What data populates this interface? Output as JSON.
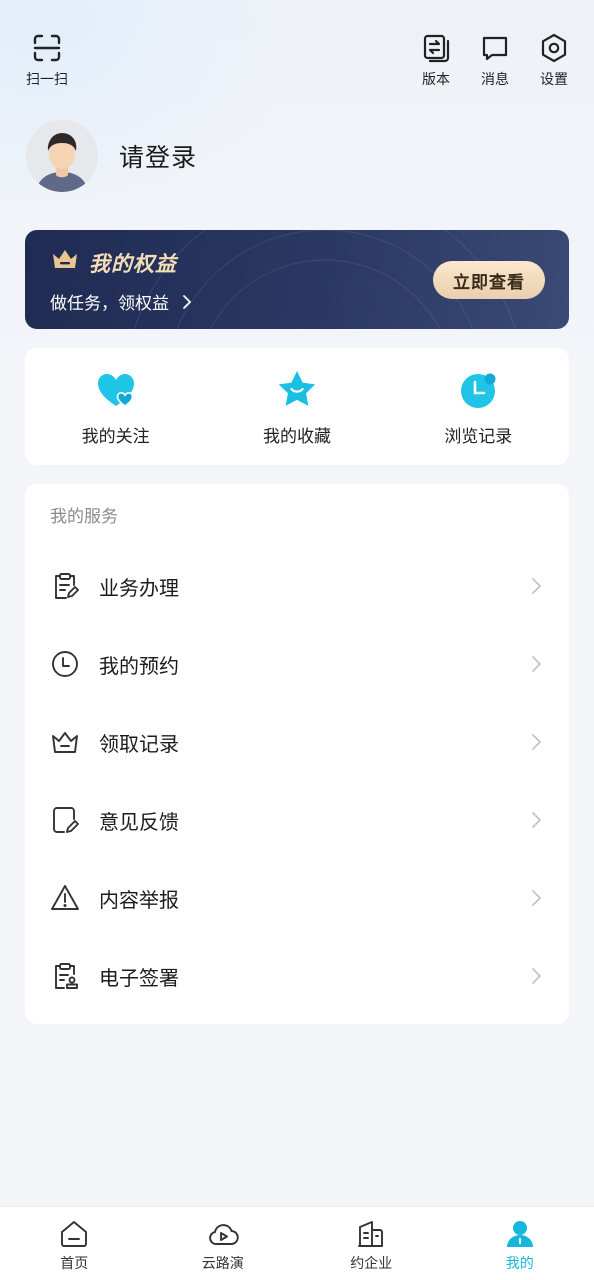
{
  "header": {
    "scan_label": "扫一扫",
    "version_label": "版本",
    "message_label": "消息",
    "settings_label": "设置"
  },
  "profile": {
    "login_prompt": "请登录"
  },
  "benefits": {
    "title": "我的权益",
    "subtitle": "做任务，领权益",
    "button_label": "立即查看"
  },
  "quick_links": [
    {
      "label": "我的关注",
      "icon": "heart-icon"
    },
    {
      "label": "我的收藏",
      "icon": "star-icon"
    },
    {
      "label": "浏览记录",
      "icon": "clock-icon"
    }
  ],
  "services": {
    "title": "我的服务",
    "items": [
      {
        "label": "业务办理",
        "icon": "clipboard-edit-icon"
      },
      {
        "label": "我的预约",
        "icon": "clock-icon"
      },
      {
        "label": "领取记录",
        "icon": "crown-icon"
      },
      {
        "label": "意见反馈",
        "icon": "note-edit-icon"
      },
      {
        "label": "内容举报",
        "icon": "warning-icon"
      },
      {
        "label": "电子签署",
        "icon": "clipboard-seal-icon"
      }
    ]
  },
  "tabbar": {
    "items": [
      {
        "label": "首页",
        "icon": "home-icon"
      },
      {
        "label": "云路演",
        "icon": "cloud-play-icon"
      },
      {
        "label": "约企业",
        "icon": "building-icon"
      },
      {
        "label": "我的",
        "icon": "user-icon"
      }
    ],
    "active_index": 3,
    "active_color": "#17b6dc"
  },
  "colors": {
    "accent": "#17b6dc",
    "banner_gold": "#f3dcb6",
    "banner_bg": "#1f2b52"
  }
}
